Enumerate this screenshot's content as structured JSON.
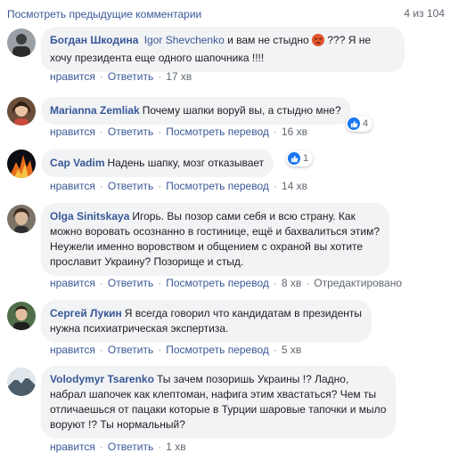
{
  "header": {
    "prev_comments": "Посмотреть предыдущие комментарии",
    "counter": "4 из 104"
  },
  "actions_labels": {
    "like": "нравится",
    "reply": "Ответить",
    "translate": "Посмотреть перевод",
    "edited": "Отредактировано"
  },
  "comments": [
    {
      "author": "Богдан Шкодина",
      "mention": "Igor Shevchenko",
      "text_before_emoji": " и вам не стыдно ",
      "emoji": "angry-face",
      "text_after_emoji_line1": " ??? Я не",
      "text_line2": "хочу президента еще одного шапочника !!!!",
      "time": "17 хв"
    },
    {
      "author": "Marianna Zemliak",
      "text": "Почему шапки воруй вы, а стыдно мне?",
      "time": "16 хв",
      "reaction_count": "4",
      "reaction_icon": "like-icon"
    },
    {
      "author": "Сар Vadim",
      "text": "Надень шапку, мозг отказывает",
      "time": "14 хв",
      "reaction_count": "1",
      "reaction_icon": "like-icon"
    },
    {
      "author": "Olga Sinitskaya",
      "line1": "Игорь. Вы позор сами себя и всю страну. Как",
      "line2": "можно воровать осознанно в гостинице, ещё и бахвалиться этим?",
      "line3": "Неужели именно воровством и общением с охраной вы хотите",
      "line4": "прославит Украину? Позорище и стыд.",
      "time": "8 хв"
    },
    {
      "author": "Сергей Лукин",
      "line1": "Я всегда говорил что кандидатам в президенты",
      "line2": "нужна психиатрическая экспертиза.",
      "time": "5 хв"
    },
    {
      "author": "Volodymyr Tsarenko",
      "line1": "Ты зачем позоришь Украины !? Ладно,",
      "line2": "набрал шапочек как клептоман, нафига этим хвастаться? Чем ты",
      "line3": "отличаешься от пацаки которые в Турции шаровые тапочки и мыло",
      "line4": "воруют !? Ты нормальный?",
      "time": "1 хв"
    }
  ],
  "colors": {
    "link": "#385898",
    "meta": "#606770",
    "bubble": "#f2f3f5",
    "like_blue": "#1877f2"
  }
}
